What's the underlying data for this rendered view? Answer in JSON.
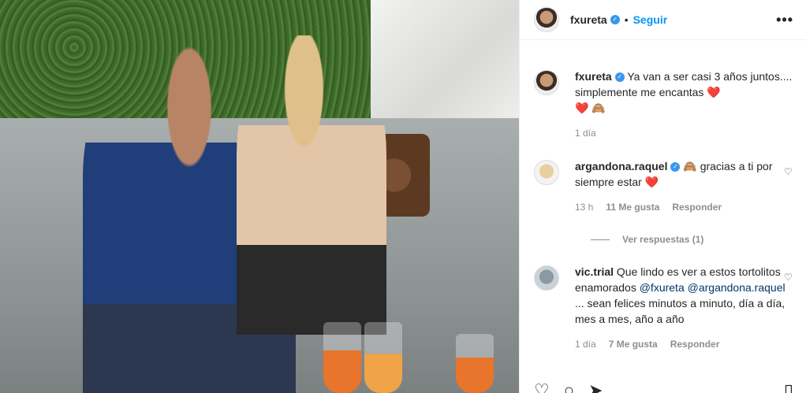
{
  "post": {
    "author": "fxureta",
    "follow_label": "Seguir",
    "more_label": "•••",
    "separator": "•",
    "verified_mark": "✓"
  },
  "caption": {
    "username": "fxureta",
    "text": "Ya van a ser casi 3 años juntos.... simplemente me encantas",
    "emoji_line": "❤️ 🙈",
    "trailing_emoji": "❤️",
    "time": "1 día"
  },
  "comments": [
    {
      "username": "argandona.raquel",
      "verified": true,
      "lead_emoji": "🙈",
      "text": "gracias a ti por siempre estar",
      "trailing_emoji": "❤️",
      "time": "13 h",
      "likes": "11 Me gusta",
      "reply_label": "Responder",
      "view_replies": "Ver respuestas (1)"
    },
    {
      "username": "vic.trial",
      "verified": false,
      "text_part1": "Que lindo es ver a estos tortolitos enamorados",
      "mention1": "@fxureta",
      "mention2": "@argandona.raquel",
      "text_part2": "... sean felices minutos a minuto, día a día, mes a mes, año a año",
      "time": "1 día",
      "likes": "7 Me gusta",
      "reply_label": "Responder"
    }
  ],
  "icons": {
    "like": "heart-icon",
    "comment": "comment-icon",
    "share": "share-icon",
    "save": "bookmark-icon"
  }
}
